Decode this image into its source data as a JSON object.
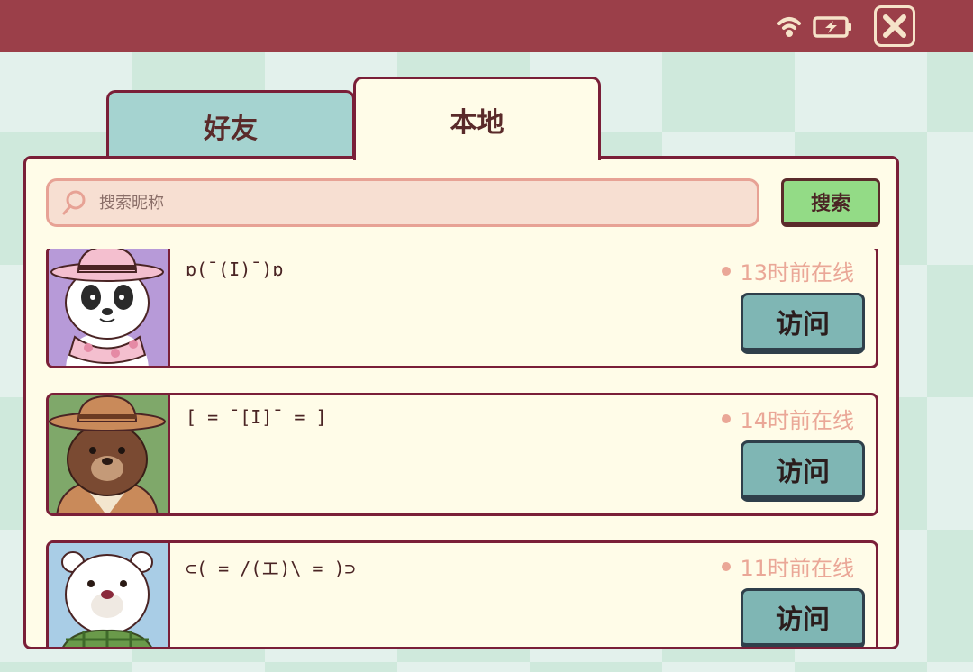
{
  "tabs": [
    {
      "label": "好友",
      "active": false
    },
    {
      "label": "本地",
      "active": true
    }
  ],
  "icons": {
    "wifi": "wifi-icon",
    "battery": "battery-charging-icon",
    "close": "close-icon",
    "search": "search-icon"
  },
  "search": {
    "placeholder": "搜索昵称",
    "value": "",
    "button_label": "搜索"
  },
  "players": [
    {
      "nickname": "ɒ(¯(I)¯)ɒ",
      "status": "13时前在线",
      "visit_label": "访问",
      "avatar": "panda-pink-hat-avatar"
    },
    {
      "nickname": "[ = ¯[I]¯  = ]",
      "status": "14时前在线",
      "visit_label": "访问",
      "avatar": "brown-bear-hat-avatar"
    },
    {
      "nickname": "⊂( = /(エ)\\  = )⊃",
      "status": "11时前在线",
      "visit_label": "访问",
      "avatar": "polar-bear-scarf-avatar"
    }
  ],
  "colors": {
    "topbar": "#9b3f49",
    "panel": "#fffce8",
    "border": "#7a1f38",
    "status_text": "#eaa797",
    "search_button": "#93db86",
    "visit_button": "#7fb6b4"
  }
}
